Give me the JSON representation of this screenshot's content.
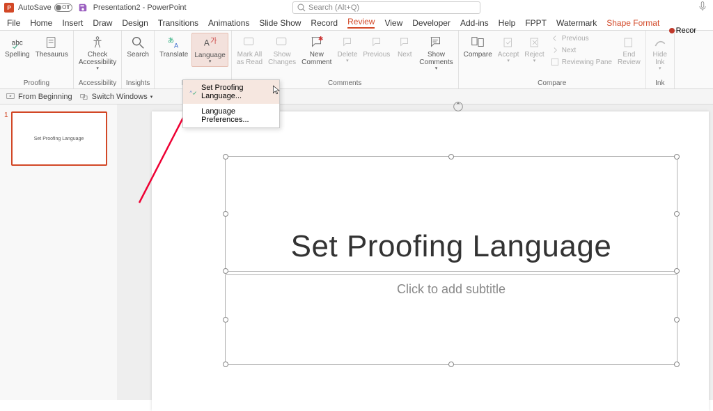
{
  "titlebar": {
    "autosave_label": "AutoSave",
    "toggle_state": "Off",
    "doc_title": "Presentation2 - PowerPoint"
  },
  "search": {
    "placeholder": "Search (Alt+Q)"
  },
  "record": {
    "label": "Recor"
  },
  "tabs": [
    "File",
    "Home",
    "Insert",
    "Draw",
    "Design",
    "Transitions",
    "Animations",
    "Slide Show",
    "Record",
    "Review",
    "View",
    "Developer",
    "Add-ins",
    "Help",
    "FPPT",
    "Watermark",
    "Shape Format"
  ],
  "tabs_active": "Review",
  "ribbon": {
    "proofing": {
      "label": "Proofing",
      "spelling": "Spelling",
      "thesaurus": "Thesaurus"
    },
    "accessibility": {
      "label": "Accessibility",
      "check": "Check\nAccessibility"
    },
    "insights": {
      "label": "Insights",
      "search": "Search"
    },
    "language": {
      "label": "Lang…",
      "translate": "Translate",
      "language": "Language"
    },
    "comments": {
      "label": "Comments",
      "markall": "Mark All\nas Read",
      "showch": "Show\nChanges",
      "newc": "New\nComment",
      "delete": "Delete",
      "previous": "Previous",
      "next": "Next",
      "showc": "Show\nComments"
    },
    "compare": {
      "label": "Compare",
      "compare": "Compare",
      "accept": "Accept",
      "reject": "Reject",
      "previous": "Previous",
      "next": "Next",
      "pane": "Reviewing Pane",
      "end": "End\nReview"
    },
    "ink": {
      "label": "Ink",
      "hide": "Hide\nInk"
    }
  },
  "secondary": {
    "from_beginning": "From Beginning",
    "switch_windows": "Switch Windows"
  },
  "lang_menu": {
    "set_proofing": "Set Proofing Language...",
    "prefs": "Language Preferences..."
  },
  "thumb": {
    "num": "1",
    "text": "Set Proofing Language"
  },
  "slide": {
    "title": "Set Proofing Language",
    "subtitle": "Click to add subtitle"
  }
}
